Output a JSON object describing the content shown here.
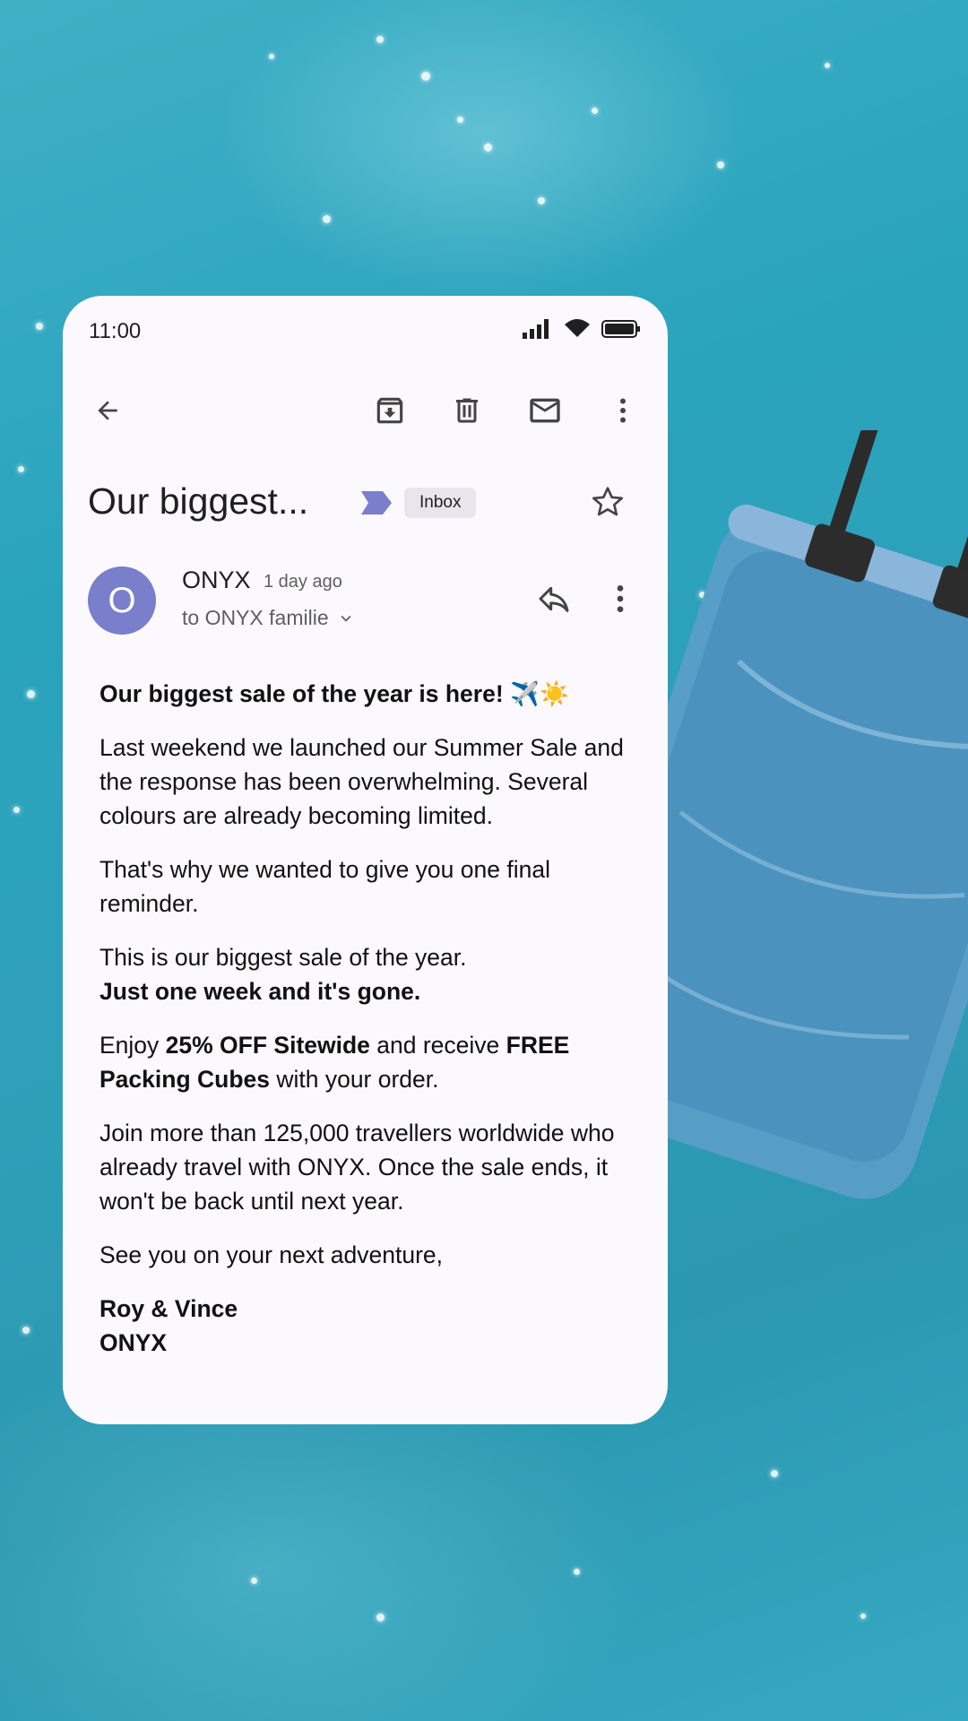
{
  "status_bar": {
    "time": "11:00"
  },
  "toolbar": {
    "icons": [
      "back-arrow-icon",
      "archive-icon",
      "trash-icon",
      "mail-icon",
      "more-vert-icon"
    ]
  },
  "email": {
    "subject": "Our biggest...",
    "label_chip": "Inbox",
    "label_color": "#7a7fcb",
    "sender": {
      "avatar_letter": "O",
      "avatar_color": "#7a7fcb",
      "name": "ONYX",
      "time": "1 day ago",
      "recipient": "to ONYX familie"
    },
    "body": {
      "headline": "Our biggest sale of the year is here!",
      "headline_emoji": "✈️☀️",
      "p1": "Last weekend we launched our Summer Sale and the response has been overwhelming. Several colours are already becoming limited.",
      "p2": "That's why we wanted to give you one final reminder.",
      "p3_line1": "This is our biggest sale of the year.",
      "p3_line2": "Just one week and it's gone.",
      "p4_a": "Enjoy ",
      "p4_b": "25% OFF Sitewide",
      "p4_c": " and receive ",
      "p4_d": "FREE Packing Cubes",
      "p4_e": " with your order.",
      "p5": "Join more than 125,000 travellers worldwide who already travel with ONYX. Once the sale ends, it won't be back until next year.",
      "p6": "See you on your next adventure,",
      "sign_line1": "Roy & Vince",
      "sign_line2": "ONYX"
    }
  }
}
